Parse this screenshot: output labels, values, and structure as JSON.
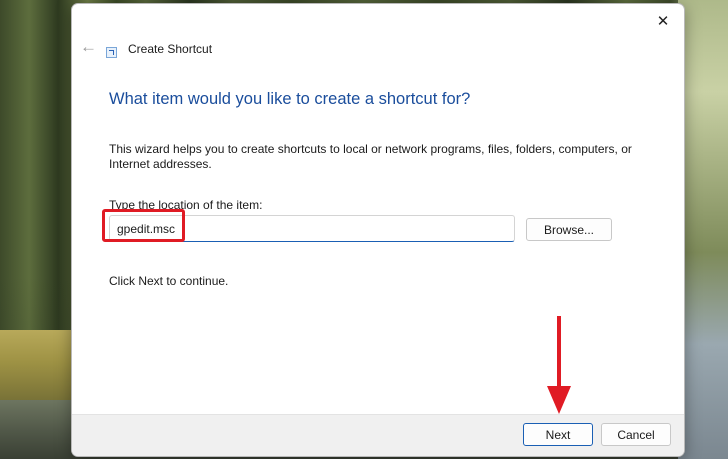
{
  "window": {
    "title": "Create Shortcut",
    "close_glyph": "✕",
    "back_glyph": "←"
  },
  "main": {
    "heading": "What item would you like to create a shortcut for?",
    "description": "This wizard helps you to create shortcuts to local or network programs, files, folders, computers, or Internet addresses.",
    "field_label": "Type the location of the item:",
    "location_value": "gpedit.msc",
    "browse_label": "Browse...",
    "continue_text": "Click Next to continue."
  },
  "footer": {
    "next_label": "Next",
    "cancel_label": "Cancel"
  },
  "annotations": {
    "highlight_color": "#e01b24",
    "arrow_color": "#e01b24"
  },
  "colors": {
    "heading": "#1a4d9c",
    "accent": "#1a5fb4"
  },
  "icons": [
    "close-icon",
    "back-arrow-icon",
    "shortcut-app-icon",
    "red-arrow-annotation"
  ]
}
